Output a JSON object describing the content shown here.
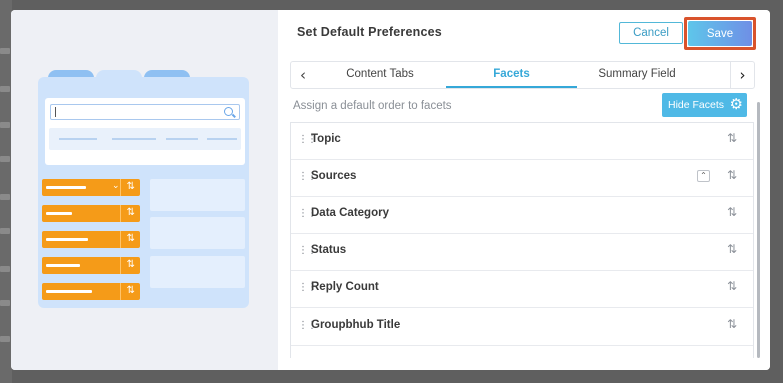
{
  "dialog": {
    "title": "Set Default Preferences",
    "cancel_label": "Cancel",
    "save_label": "Save"
  },
  "tabs": {
    "items": [
      {
        "label": "Content Tabs",
        "active": false
      },
      {
        "label": "Facets",
        "active": true
      },
      {
        "label": "Summary Field",
        "active": false
      }
    ],
    "prev_icon": "chevron-left-icon",
    "next_icon": "chevron-right-icon"
  },
  "facets": {
    "hint": "Assign a default order to facets",
    "hide_button_label": "Hide Facets",
    "hide_button_icon": "gear-icon",
    "rows": [
      {
        "label": "Topic"
      },
      {
        "label": "Sources",
        "collapsible": true
      },
      {
        "label": "Data Category"
      },
      {
        "label": "Status"
      },
      {
        "label": "Reply Count"
      },
      {
        "label": "Groupbhub Title"
      }
    ]
  },
  "colors": {
    "accent": "#35a8d8",
    "save_gradient_start": "#5ec6ea",
    "save_gradient_end": "#6f8fe6",
    "highlight_border": "#d9532c",
    "illustration_orange": "#f59b18",
    "illustration_blue": "#cfe3fb"
  }
}
